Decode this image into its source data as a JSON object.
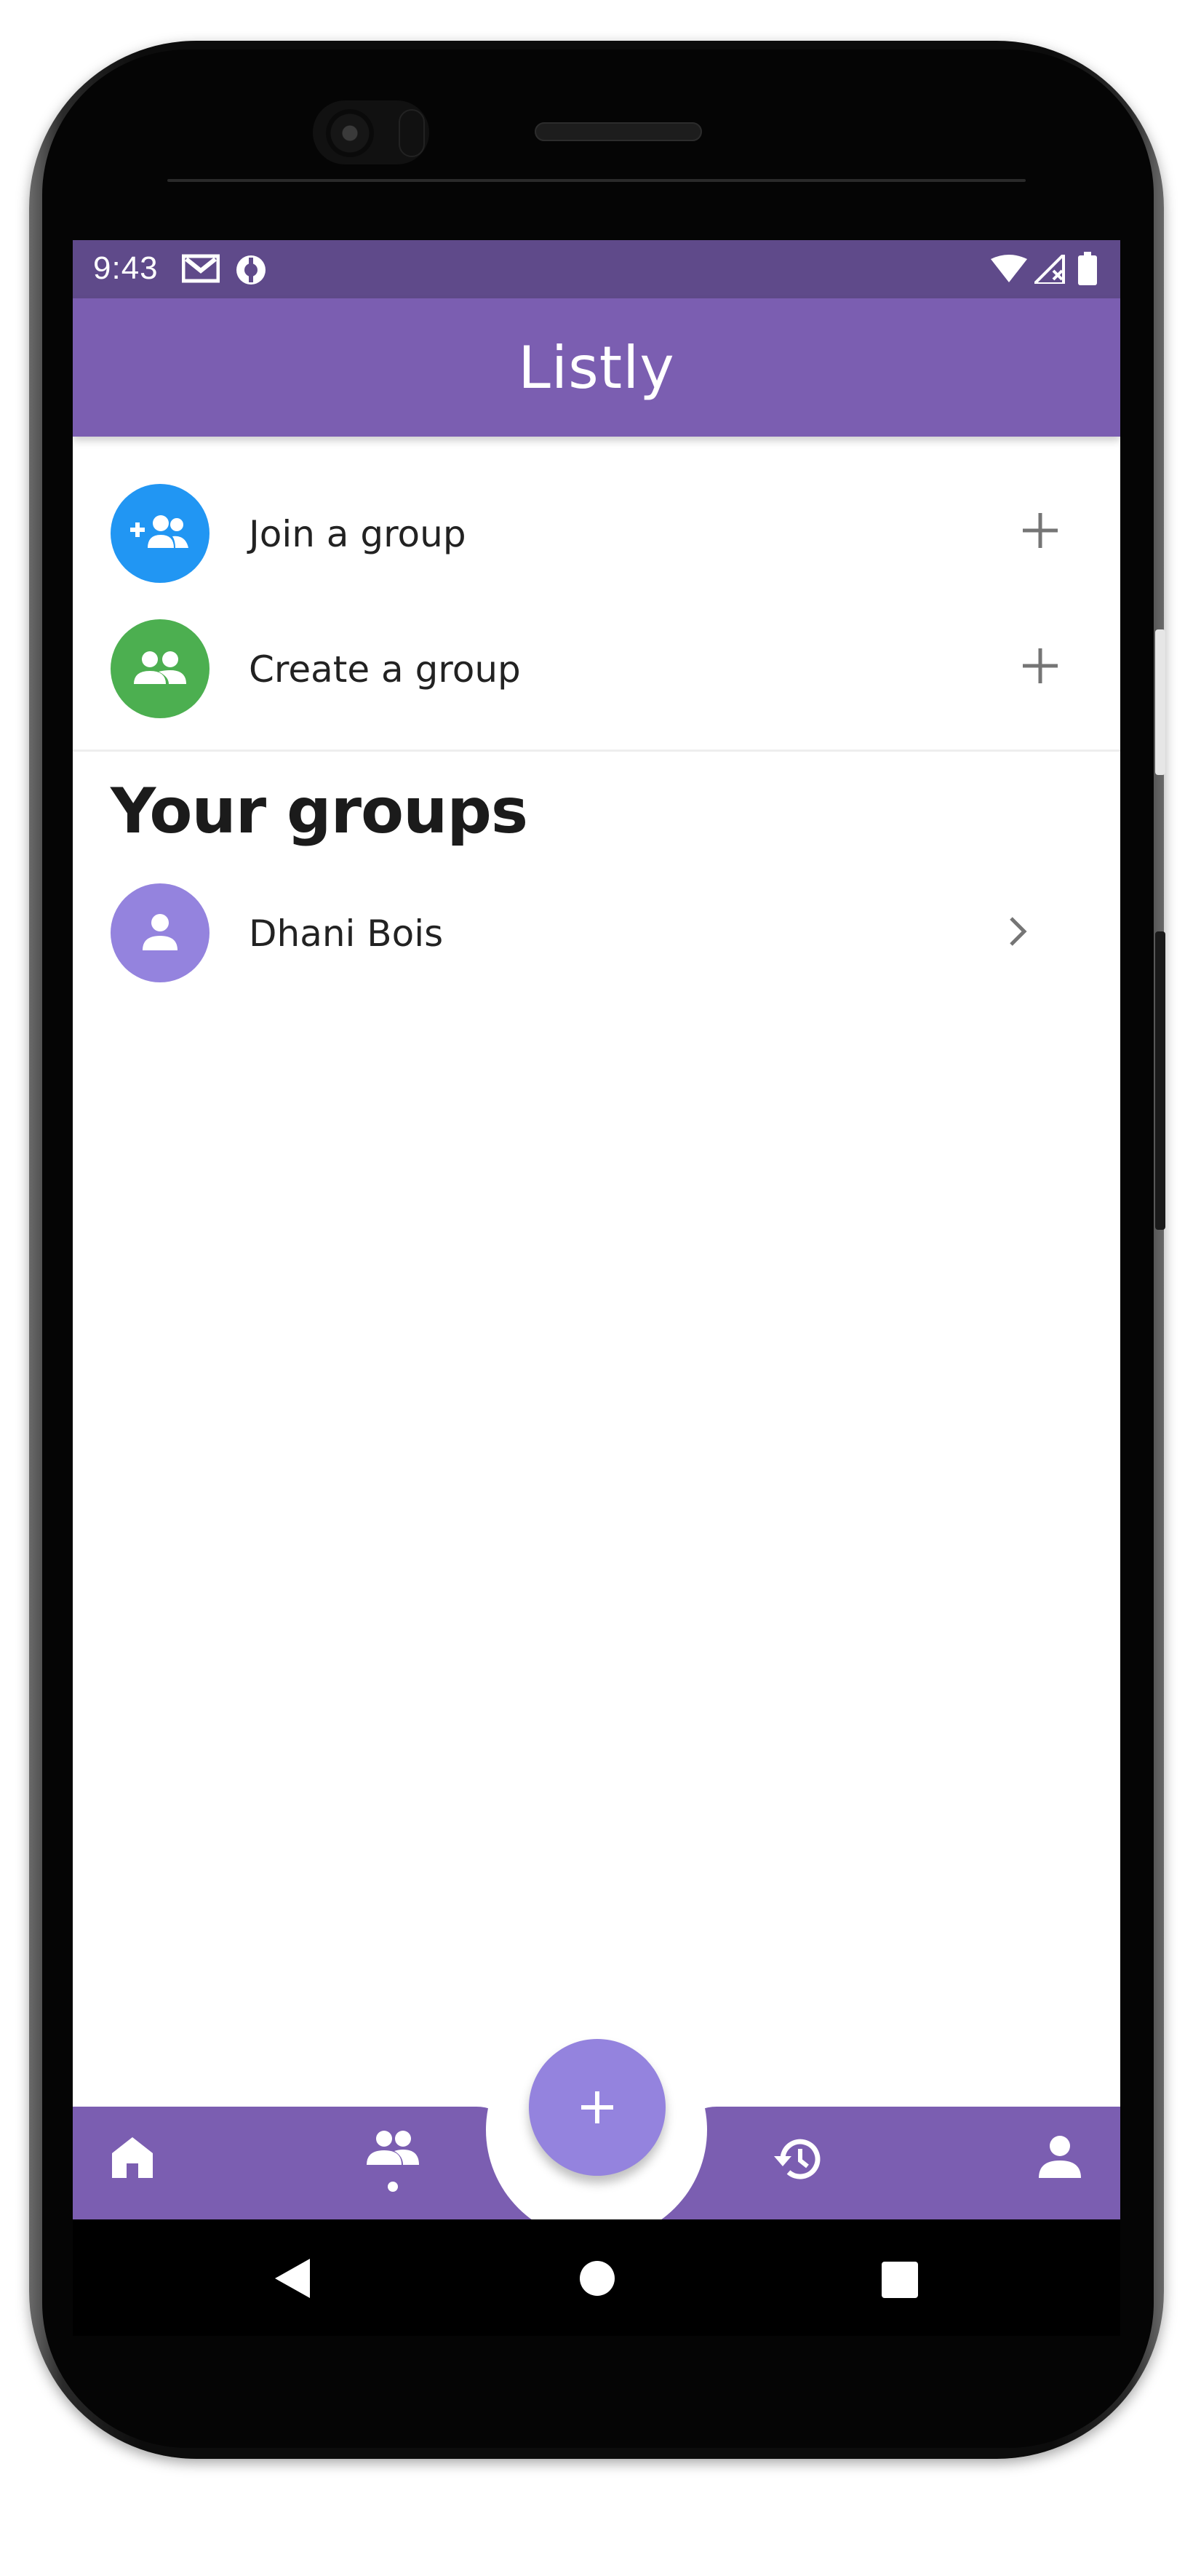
{
  "status_bar": {
    "time": "9:43",
    "left_icons": [
      "gmail-icon",
      "app-notification-icon"
    ],
    "right_icons": [
      "wifi-icon",
      "signal-icon",
      "battery-icon"
    ]
  },
  "app_bar": {
    "title": "Listly"
  },
  "actions": [
    {
      "label": "Join a group",
      "icon": "group-add-icon",
      "color": "#2196f3",
      "trailing": "plus-icon"
    },
    {
      "label": "Create a group",
      "icon": "group-icon",
      "color": "#4caf50",
      "trailing": "plus-icon"
    }
  ],
  "groups_section": {
    "title": "Your groups",
    "items": [
      {
        "name": "Dhani Bois",
        "icon": "person-icon",
        "color": "#9483de",
        "trailing": "chevron-right-icon"
      }
    ]
  },
  "bottom_nav": {
    "items": [
      "home-icon",
      "groups-icon",
      "history-icon",
      "profile-icon"
    ],
    "fab_icon": "plus-icon",
    "color": "#7b5eb1",
    "fab_color": "#9483de"
  },
  "system_nav": {
    "items": [
      "back-icon",
      "home-circle-icon",
      "recents-icon"
    ]
  },
  "colors": {
    "status_bar": "#5f4a8a",
    "primary": "#7b5eb1",
    "accent": "#9483de"
  }
}
